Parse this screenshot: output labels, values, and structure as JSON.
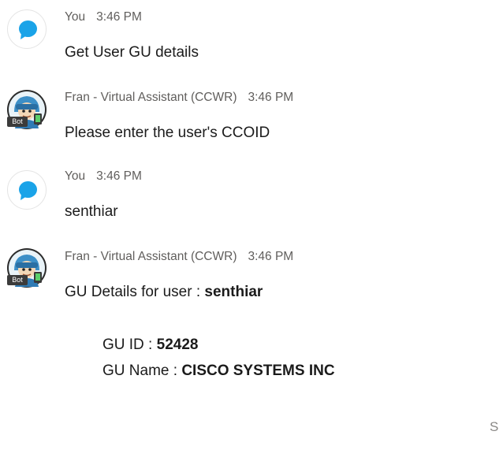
{
  "messages": [
    {
      "sender": "You",
      "time": "3:46 PM",
      "text": "Get User GU details"
    },
    {
      "sender": "Fran - Virtual Assistant (CCWR)",
      "time": "3:46 PM",
      "text": "Please enter the user's CCOID",
      "badge": "Bot"
    },
    {
      "sender": "You",
      "time": "3:46 PM",
      "text": "senthiar"
    },
    {
      "sender": "Fran - Virtual Assistant (CCWR)",
      "time": "3:46 PM",
      "badge": "Bot",
      "intro_label": "GU Details for user : ",
      "intro_user": "senthiar",
      "gu_id_label": "GU ID : ",
      "gu_id_value": "52428",
      "gu_name_label": "GU Name : ",
      "gu_name_value": "CISCO SYSTEMS INC"
    }
  ],
  "edge_text": "S",
  "icons": {
    "user_avatar": "chat-bubble-icon",
    "bot_avatar": "assistant-avatar-icon"
  },
  "colors": {
    "user_bubble": "#1aa3e8",
    "bot_badge_bg": "#3b3b3b"
  }
}
